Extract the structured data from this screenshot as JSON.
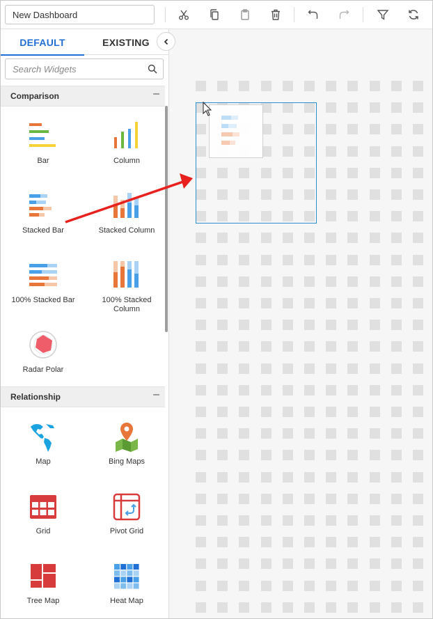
{
  "toolbar": {
    "dashboard_title": "New Dashboard",
    "icons": [
      "cut-icon",
      "copy-icon",
      "paste-icon",
      "delete-icon",
      "undo-icon",
      "redo-icon",
      "filter-icon",
      "refresh-icon"
    ]
  },
  "panel": {
    "tabs": [
      {
        "label": "DEFAULT",
        "active": true
      },
      {
        "label": "EXISTING",
        "active": false
      }
    ],
    "search": {
      "placeholder": "Search Widgets"
    },
    "sections": [
      {
        "title": "Comparison",
        "toggle": "–",
        "widgets": [
          {
            "label": "Bar",
            "icon": "bar-chart-icon"
          },
          {
            "label": "Column",
            "icon": "column-chart-icon"
          },
          {
            "label": "Stacked Bar",
            "icon": "stacked-bar-icon"
          },
          {
            "label": "Stacked Column",
            "icon": "stacked-column-icon"
          },
          {
            "label": "100% Stacked Bar",
            "icon": "percent-stacked-bar-icon"
          },
          {
            "label": "100% Stacked Column",
            "icon": "percent-stacked-column-icon"
          },
          {
            "label": "Radar Polar",
            "icon": "radar-polar-icon"
          }
        ]
      },
      {
        "title": "Relationship",
        "toggle": "–",
        "widgets": [
          {
            "label": "Map",
            "icon": "world-map-icon"
          },
          {
            "label": "Bing Maps",
            "icon": "bing-maps-pin-icon"
          },
          {
            "label": "Grid",
            "icon": "grid-icon"
          },
          {
            "label": "Pivot Grid",
            "icon": "pivot-grid-icon"
          },
          {
            "label": "Tree Map",
            "icon": "tree-map-icon"
          },
          {
            "label": "Heat Map",
            "icon": "heat-map-icon"
          }
        ]
      }
    ]
  },
  "colors": {
    "accent": "#1f6fd6",
    "drop_border": "#2c8ecf",
    "arrow": "#e8201e",
    "bar_orange": "#e8763a",
    "bar_blue": "#4aa0e8",
    "bar_yellow": "#f5d338",
    "bar_green": "#6ab742",
    "grid_red": "#d83b3b"
  }
}
